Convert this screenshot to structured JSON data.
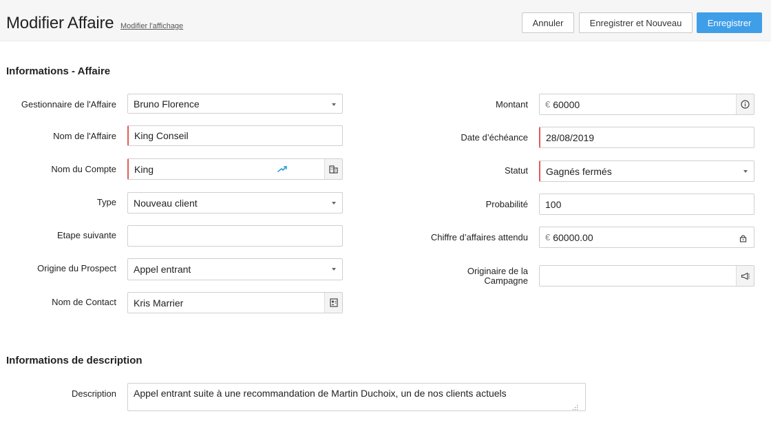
{
  "header": {
    "title": "Modifier Affaire",
    "layout_link": "Modifier l'affichage",
    "cancel_label": "Annuler",
    "save_new_label": "Enregistrer et Nouveau",
    "save_label": "Enregistrer",
    "accent_color": "#3f9ee8"
  },
  "sections": {
    "deal_info": "Informations - Affaire",
    "description_info": "Informations de description"
  },
  "left_fields": {
    "owner": {
      "label": "Gestionnaire de l'Affaire",
      "value": "Bruno Florence"
    },
    "deal_name": {
      "label": "Nom de l'Affaire",
      "value": "King Conseil"
    },
    "account_name": {
      "label": "Nom du Compte",
      "value": "King"
    },
    "type": {
      "label": "Type",
      "value": "Nouveau client"
    },
    "next_step": {
      "label": "Etape suivante",
      "value": ""
    },
    "lead_source": {
      "label": "Origine du Prospect",
      "value": "Appel entrant"
    },
    "contact_name": {
      "label": "Nom de Contact",
      "value": "Kris Marrier"
    }
  },
  "right_fields": {
    "amount": {
      "label": "Montant",
      "currency": "€",
      "value": "60000"
    },
    "closing_date": {
      "label": "Date d’échéance",
      "value": "28/08/2019"
    },
    "stage": {
      "label": "Statut",
      "value": "Gagnés fermés"
    },
    "probability": {
      "label": "Probabilité",
      "value": "100"
    },
    "expected_revenue": {
      "label": "Chiffre d’affaires attendu",
      "currency": "€",
      "value": "60000.00"
    },
    "campaign_source": {
      "label_line1": "Originaire de la",
      "label_line2": "Campagne",
      "value": ""
    }
  },
  "description": {
    "label": "Description",
    "value": "Appel entrant suite à une recommandation de Martin Duchoix, un de nos clients actuels"
  },
  "icons": {
    "account_lookup": "building-icon",
    "account_link": "lookup-link-icon",
    "contact_lookup": "contact-card-icon",
    "amount_info": "info-icon",
    "revenue_lock": "lock-icon",
    "campaign_lookup": "megaphone-icon"
  },
  "colors": {
    "required_marker": "#e05a5a",
    "link_icon": "#2a9bd6"
  }
}
